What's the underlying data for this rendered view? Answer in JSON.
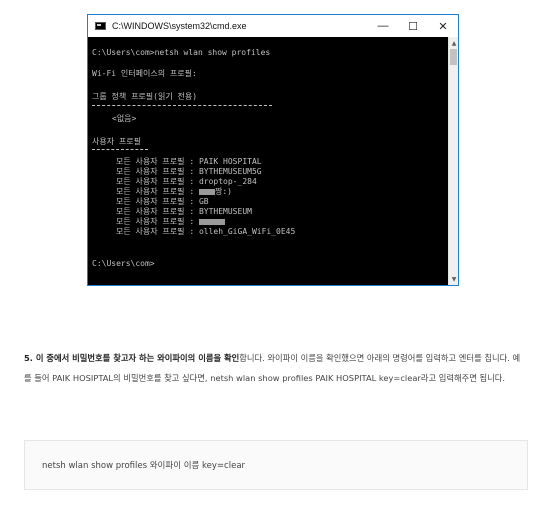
{
  "window": {
    "title": "C:\\WINDOWS\\system32\\cmd.exe",
    "minimize": "—",
    "maximize": "☐",
    "close": "✕"
  },
  "console": {
    "command": "C:\\Users\\com>netsh wlan show profiles",
    "interface_header": "Wi-Fi 인터페이스의 프로필:",
    "group_header": "그룹 정책 프로필(읽기 전용)",
    "none": "<없음>",
    "user_header": "사용자 프로필",
    "profile_label": "모든 사용자 프로필 : ",
    "profiles": [
      "PAIK HOSPITAL",
      "BYTHEMUSEUM5G",
      "droptop-_284",
      "짱:)",
      "GB",
      "BYTHEMUSEUM",
      "",
      "olleh_GiGA_WiFi_0E45"
    ],
    "prompt": "C:\\Users\\com>"
  },
  "article": {
    "step_number": "5. ",
    "step_bold": "이 중에서 비밀번호를 찾고자 하는 와이파이의 이름을 확인",
    "step_text": "합니다. 와이파이 이름을 확인했으면 아래의 명령어를 입력하고 엔터를 칩니다. 예를 들어 PAIK HOSIPTAL의 비밀번호를 찾고 싶다면, netsh wlan show profiles PAIK HOSPITAL key=clear라고 입력해주면 됩니다.",
    "code": "netsh wlan show profiles 와이파이 이름 key=clear"
  }
}
